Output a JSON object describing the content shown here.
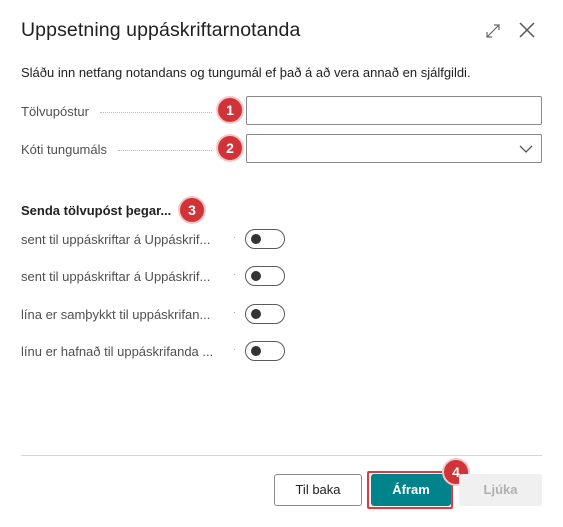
{
  "dialog": {
    "title": "Uppsetning uppáskriftarnotanda",
    "description": "Sláðu inn netfang notandans og tungumál ef það á að vera annað en sjálfgildi."
  },
  "fields": {
    "email_label": "Tölvupóstur",
    "email_value": "",
    "language_label": "Kóti tungumáls",
    "language_value": ""
  },
  "section": {
    "heading": "Senda tölvupóst þegar..."
  },
  "toggles": [
    {
      "label": "sent til uppáskriftar á Uppáskrif...",
      "on": false
    },
    {
      "label": "sent til uppáskriftar á Uppáskrif...",
      "on": false
    },
    {
      "label": "lína er samþykkt til uppáskrifan...",
      "on": false
    },
    {
      "label": "línu er hafnað til uppáskrifanda ...",
      "on": false
    }
  ],
  "buttons": {
    "back": "Til baka",
    "next": "Áfram",
    "finish": "Ljúka"
  },
  "annotations": [
    "1",
    "2",
    "3",
    "4"
  ],
  "colors": {
    "primary_button": "#00838a",
    "callout_badge": "#d13438",
    "highlight_border": "#e0393e"
  },
  "icons": {
    "expand": "expand-icon",
    "close": "close-icon",
    "dropdown": "chevron-down-icon"
  }
}
